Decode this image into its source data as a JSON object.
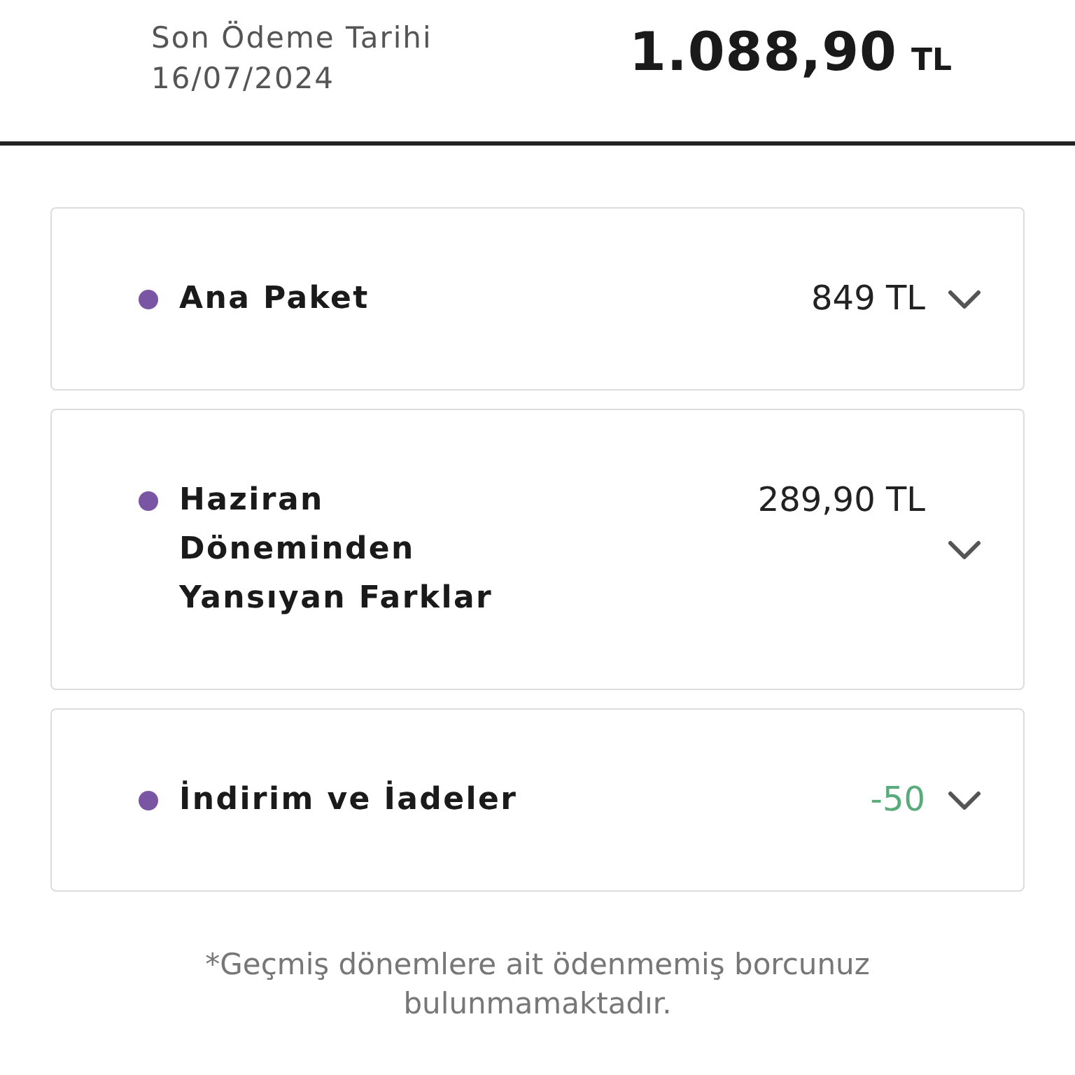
{
  "header": {
    "due_label": "Son Ödeme Tarihi",
    "due_date": "16/07/2024",
    "total": "1.088,90",
    "currency": "TL"
  },
  "items": [
    {
      "title": "Ana Paket",
      "amount": "849 TL",
      "kind": "charge",
      "expanded": false
    },
    {
      "title": "Haziran Döneminden Yansıyan Farklar",
      "amount": "289,90 TL",
      "kind": "charge",
      "expanded": false
    },
    {
      "title": "İndirim ve İadeler",
      "amount": "-50",
      "kind": "credit",
      "expanded": false
    }
  ],
  "footnote": "*Geçmiş dönemlere ait ödenmemiş borcunuz bulunmamaktadır."
}
